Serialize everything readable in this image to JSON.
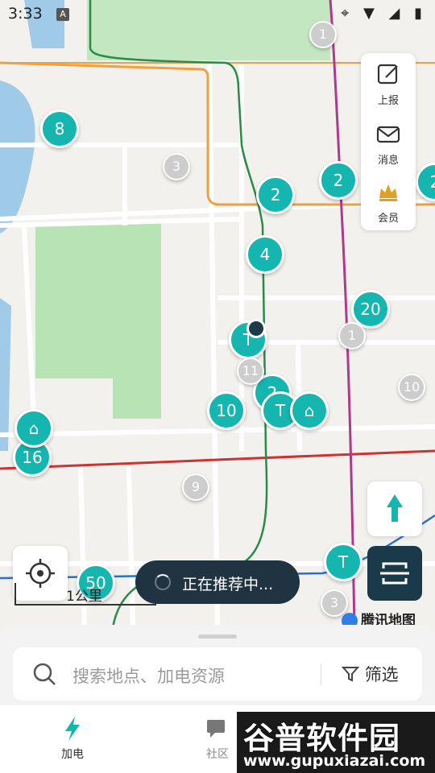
{
  "status_bar": {
    "time": "3:33",
    "app_badge": "A",
    "icons": "⌖ ▼ ◢ ▮"
  },
  "map": {
    "station_pins": [
      "8",
      "2",
      "2",
      "2",
      "4",
      "20",
      "10",
      "16",
      "50",
      "2"
    ],
    "gray_pins": [
      "1",
      "3",
      "1",
      "11",
      "10",
      "9",
      "3"
    ],
    "colors": {
      "pin": "#15b5b0",
      "gray_pin": "#cdcdcd",
      "park": "#b7e3b5",
      "water": "#9fcbe8"
    }
  },
  "side_panel": {
    "items": [
      {
        "label": "上报",
        "icon": "report-icon"
      },
      {
        "label": "消息",
        "icon": "mail-icon"
      },
      {
        "label": "会员",
        "icon": "crown-icon"
      }
    ]
  },
  "toast": {
    "text": "正在推荐中..."
  },
  "scale": {
    "label": "1公里"
  },
  "brand": {
    "label": "腾讯地图"
  },
  "search": {
    "placeholder": "搜索地点、加电资源",
    "filter_label": "筛选"
  },
  "tabs": [
    {
      "label": "加电",
      "icon": "bolt-icon",
      "active": true
    },
    {
      "label": "社区",
      "icon": "chat-icon",
      "active": false
    }
  ],
  "watermark": {
    "title": "谷普软件园",
    "url": "www.gupuxiazai.com"
  }
}
